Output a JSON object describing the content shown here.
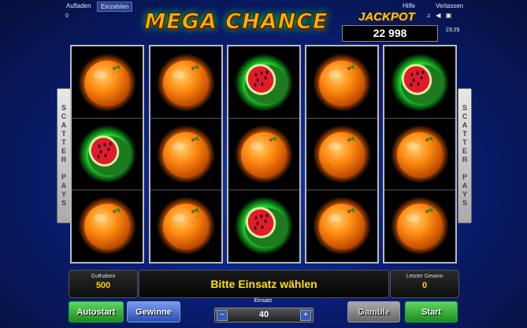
{
  "topbar": {
    "aufladen": "Aufladen",
    "einzahlen": "Einzahlen",
    "hilfe": "Hilfe",
    "verlassen": "Verlassen",
    "credit_small": "0",
    "clock": "23:25"
  },
  "title": "MEGA CHANCE",
  "jackpot": {
    "label": "JACKPOT",
    "value": "22 998"
  },
  "scatter_text": [
    "S",
    "C",
    "A",
    "T",
    "T",
    "E",
    "R",
    " ",
    "P",
    "A",
    "Y",
    "S"
  ],
  "reels": [
    [
      "orange",
      "watermelon",
      "orange"
    ],
    [
      "orange",
      "orange",
      "orange"
    ],
    [
      "watermelon",
      "orange",
      "watermelon"
    ],
    [
      "orange",
      "orange",
      "orange"
    ],
    [
      "watermelon",
      "orange",
      "orange"
    ]
  ],
  "guthaben": {
    "label": "Guthaben",
    "value": "500"
  },
  "message": "Bitte Einsatz wählen",
  "letzter_gewinn": {
    "label": "Letzter Gewinn",
    "value": "0"
  },
  "buttons": {
    "autostart": "Autostart",
    "gewinne": "Gewinne",
    "gamble": "Gamble",
    "start": "Start"
  },
  "einsatz": {
    "label": "Einsatz",
    "value": "40",
    "minus": "−",
    "plus": "+"
  },
  "icons": {
    "music": "music-note-icon",
    "sound": "speaker-icon",
    "fullscreen": "fullscreen-icon"
  }
}
